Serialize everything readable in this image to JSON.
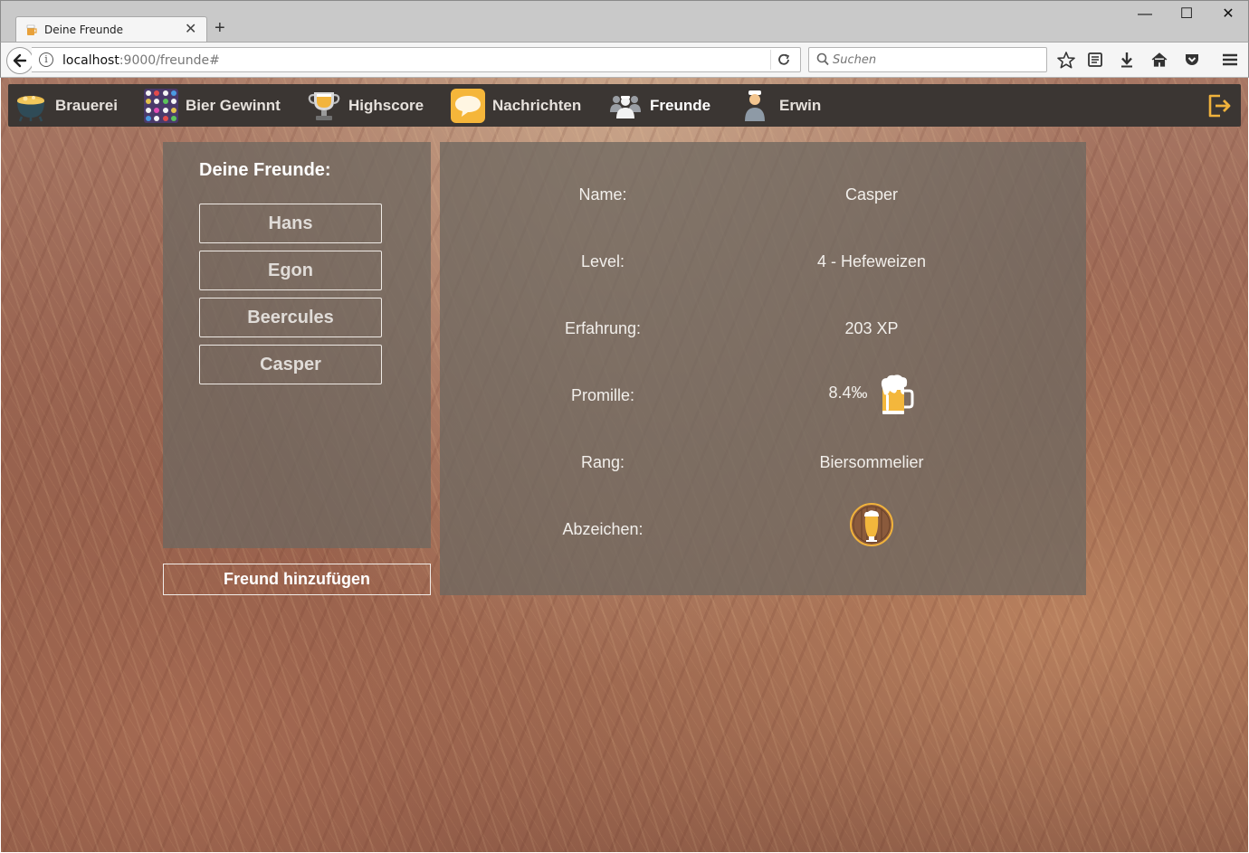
{
  "browser": {
    "tab_title": "Deine Freunde",
    "url_host": "localhost",
    "url_rest": ":9000/freunde#",
    "search_placeholder": "Suchen"
  },
  "nav": {
    "items": [
      {
        "label": "Brauerei",
        "icon": "cauldron-icon"
      },
      {
        "label": "Bier Gewinnt",
        "icon": "game-grid-icon"
      },
      {
        "label": "Highscore",
        "icon": "trophy-icon"
      },
      {
        "label": "Nachrichten",
        "icon": "speech-bubble-icon"
      },
      {
        "label": "Freunde",
        "icon": "friends-icon",
        "active": true
      },
      {
        "label": "Erwin",
        "icon": "user-icon"
      }
    ],
    "logout_icon": "logout-icon"
  },
  "friends": {
    "title": "Deine Freunde:",
    "list": [
      "Hans",
      "Egon",
      "Beercules",
      "Casper"
    ],
    "add_button": "Freund hinzufügen"
  },
  "detail": {
    "labels": {
      "name": "Name:",
      "level": "Level:",
      "xp": "Erfahrung:",
      "promille": "Promille:",
      "rank": "Rang:",
      "badges": "Abzeichen:"
    },
    "values": {
      "name": "Casper",
      "level": "4 - Hefeweizen",
      "xp": "203 XP",
      "promille": "8.4‰",
      "rank": "Biersommelier"
    },
    "promille_icon": "beer-mug-icon",
    "badge_icon": "wheat-beer-badge-icon"
  },
  "colors": {
    "nav_bg": "#3b3633",
    "panel_bg": "rgba(110,104,96,0.78)",
    "accent": "#f0b23c"
  }
}
